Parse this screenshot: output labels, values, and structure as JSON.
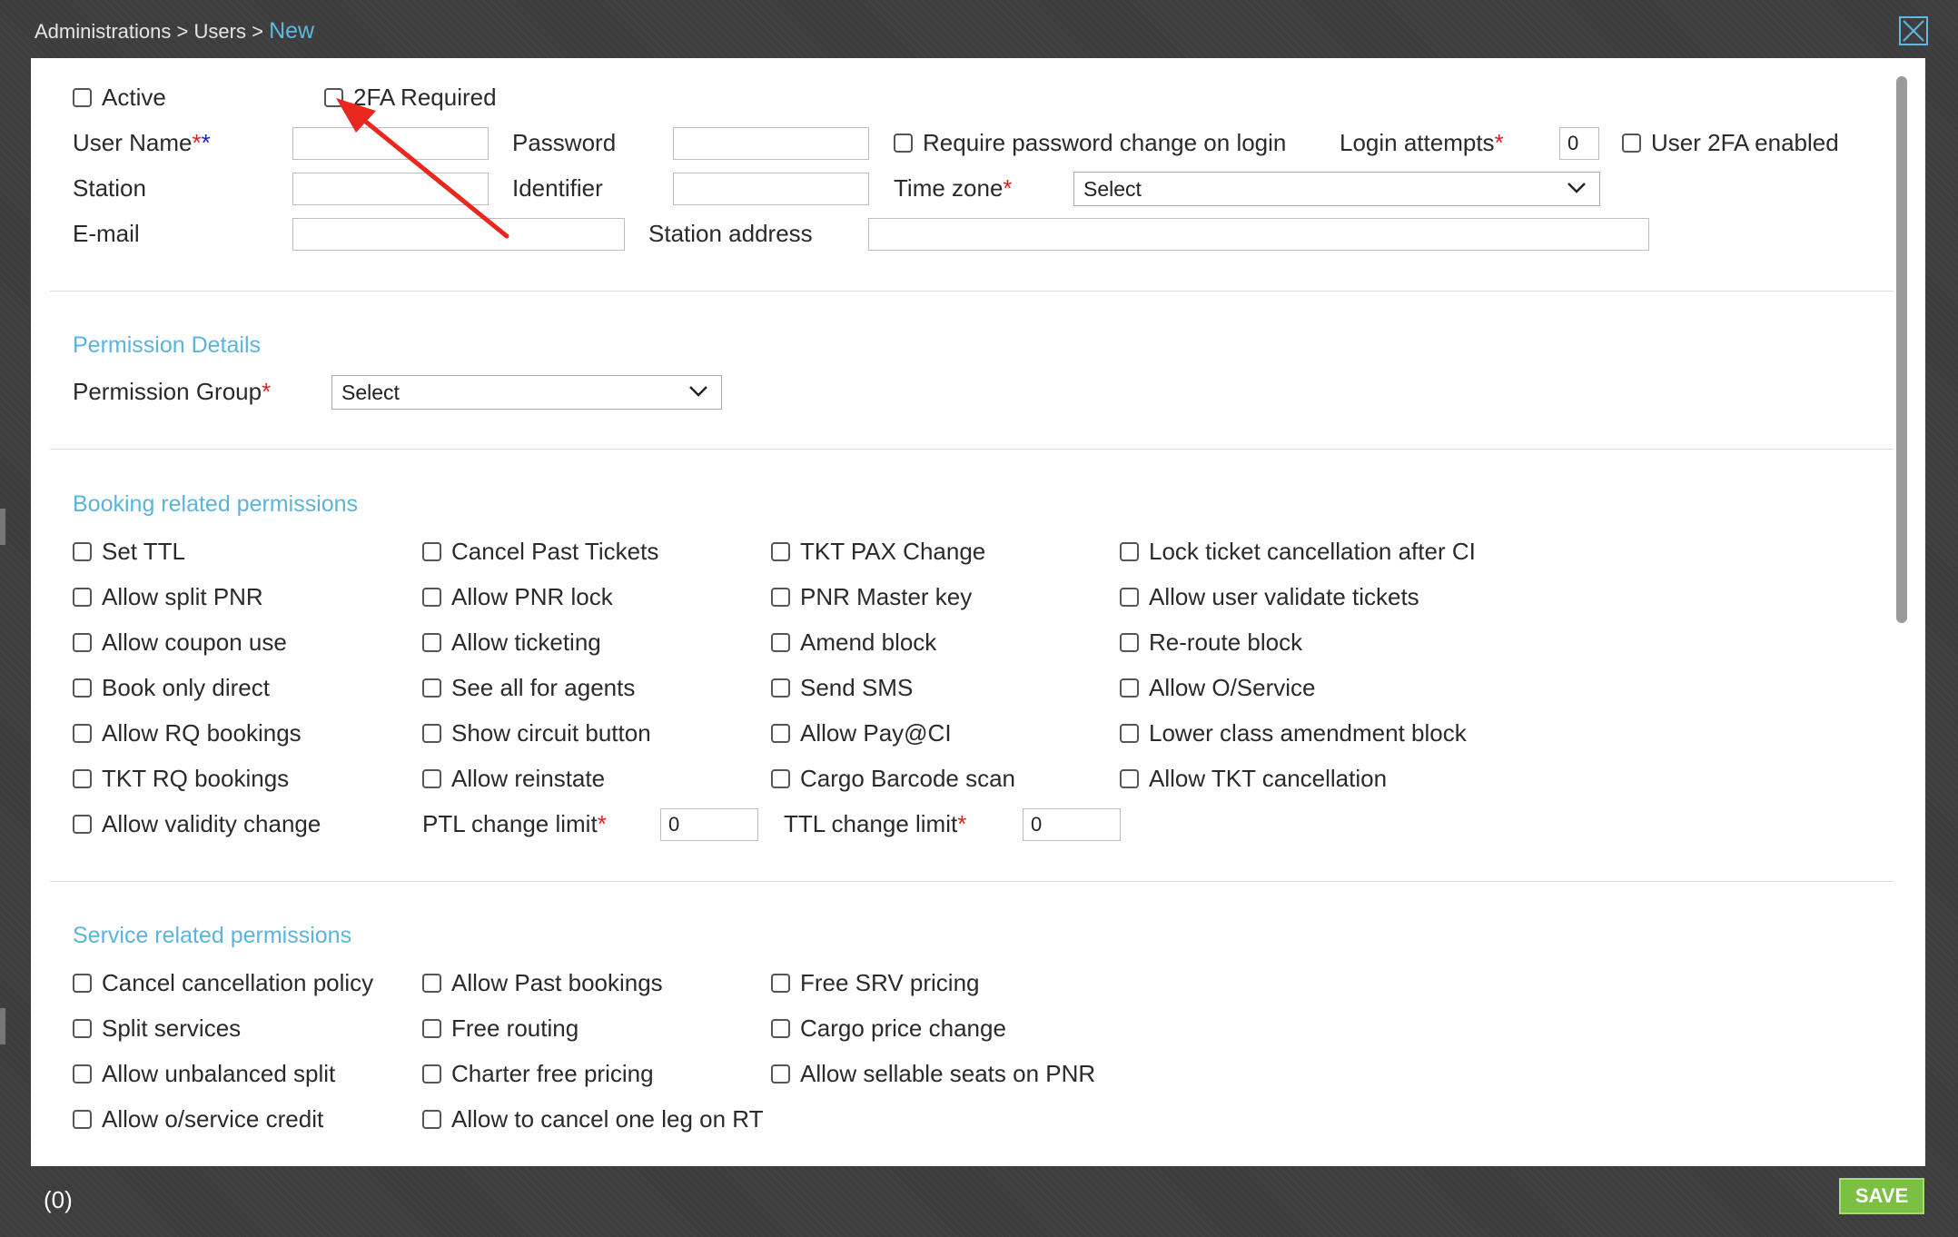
{
  "breadcrumb": {
    "part1": "Administrations",
    "sep": ">",
    "part2": "Users",
    "current": "New"
  },
  "colors": {
    "accent": "#5fb8e0",
    "required": "#e02020",
    "save": "#7bc043"
  },
  "user": {
    "active_label": "Active",
    "twofa_required_label": "2FA Required",
    "username_label": "User Name",
    "password_label": "Password",
    "require_pw_change_label": "Require password change on login",
    "login_attempts_label": "Login attempts",
    "login_attempts_value": "0",
    "user_2fa_enabled_label": "User 2FA enabled",
    "station_label": "Station",
    "identifier_label": "Identifier",
    "timezone_label": "Time zone",
    "timezone_value": "Select",
    "email_label": "E-mail",
    "station_address_label": "Station address"
  },
  "permission_details": {
    "title": "Permission Details",
    "group_label": "Permission Group",
    "group_value": "Select"
  },
  "booking": {
    "title": "Booking related permissions",
    "col1": [
      "Set TTL",
      "Allow split PNR",
      "Allow coupon use",
      "Book only direct",
      "Allow RQ bookings",
      "TKT RQ bookings",
      "Allow validity change"
    ],
    "col2": [
      "Cancel Past Tickets",
      "Allow PNR lock",
      "Allow ticketing",
      "See all for agents",
      "Show circuit button",
      "Allow reinstate"
    ],
    "col3": [
      "TKT PAX Change",
      "PNR Master key",
      "Amend block",
      "Send SMS",
      "Allow Pay@CI",
      "Cargo Barcode scan"
    ],
    "col4": [
      "Lock ticket cancellation after CI",
      "Allow user validate tickets",
      "Re-route block",
      "Allow O/Service",
      "Lower class amendment block",
      "Allow TKT cancellation"
    ],
    "ptl_label": "PTL change limit",
    "ptl_value": "0",
    "ttl_label": "TTL change limit",
    "ttl_value": "0"
  },
  "service": {
    "title": "Service related permissions",
    "col1": [
      "Cancel cancellation policy",
      "Split services",
      "Allow unbalanced split",
      "Allow o/service credit"
    ],
    "col2": [
      "Allow Past bookings",
      "Free routing",
      "Charter free pricing",
      "Allow to cancel one leg on RT"
    ],
    "col3": [
      "Free SRV pricing",
      "Cargo price change",
      "Allow sellable seats on PNR"
    ]
  },
  "footer": {
    "count": "(0)",
    "save_label": "SAVE"
  }
}
